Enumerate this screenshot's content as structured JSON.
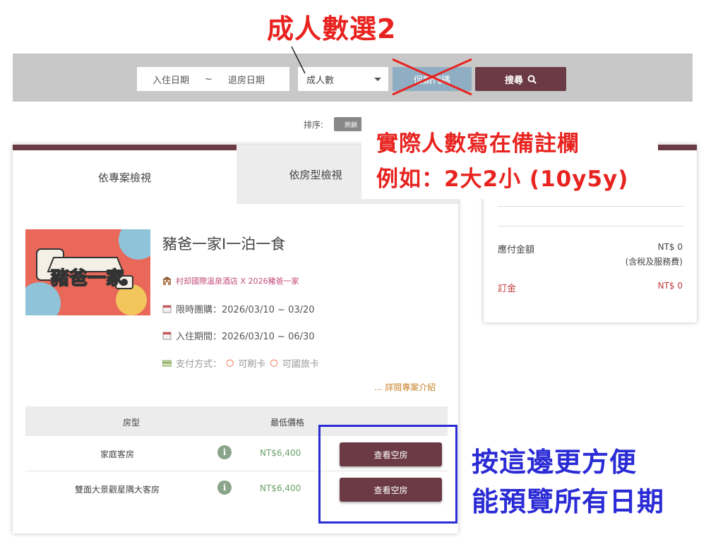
{
  "annotations": {
    "top": "成人數選2",
    "remark_line1": "實際人數寫在備註欄",
    "remark_line2": "例如：2大2小 (10y5y)",
    "blue_line1": "按這邊更方便",
    "blue_line2": "能預覽所有日期",
    "colors": {
      "red": "#e8231f",
      "blue": "#2b2bd6"
    }
  },
  "search": {
    "checkin_placeholder": "入住日期",
    "separator": "~",
    "checkout_placeholder": "退房日期",
    "adults_placeholder": "成人數",
    "promo_label": "促銷代碼",
    "search_label": "搜尋"
  },
  "sort": {
    "label": "排序:",
    "option": "熱銷"
  },
  "tabs": [
    {
      "label": "依專案檢視",
      "active": true
    },
    {
      "label": "依房型檢視",
      "active": false
    }
  ],
  "package": {
    "title": "豬爸一家I一泊一食",
    "image_text": "豬爸一家",
    "hotel": "村却國際溫泉酒店 X 2026豬爸一家",
    "group_buy": "限時團購：2026/03/10 ~ 03/20",
    "stay_period": "入住期間：2026/03/10 ~ 06/30",
    "payment_prefix": "支付方式：",
    "payment_opt1": "可刷卡",
    "payment_opt2": "可國旅卡",
    "detail_link": "... 詳閱專案介紹"
  },
  "room_table": {
    "headers": [
      "房型",
      "最低價格"
    ],
    "rows": [
      {
        "name": "家庭客房",
        "price": "NT$6,400",
        "button": "查看空房"
      },
      {
        "name": "雙面大景觀星隅大客房",
        "price": "NT$6,400",
        "button": "查看空房"
      }
    ]
  },
  "summary": {
    "payable_label": "應付金額",
    "payable_value": "NT$ 0",
    "payable_note": "(含稅及服務費)",
    "deposit_label": "訂金",
    "deposit_value": "NT$ 0"
  },
  "theme": {
    "brand": "#6b3a45",
    "promo": "#8faec4",
    "price_green": "#6aa26a",
    "link_orange": "#c8822e"
  }
}
